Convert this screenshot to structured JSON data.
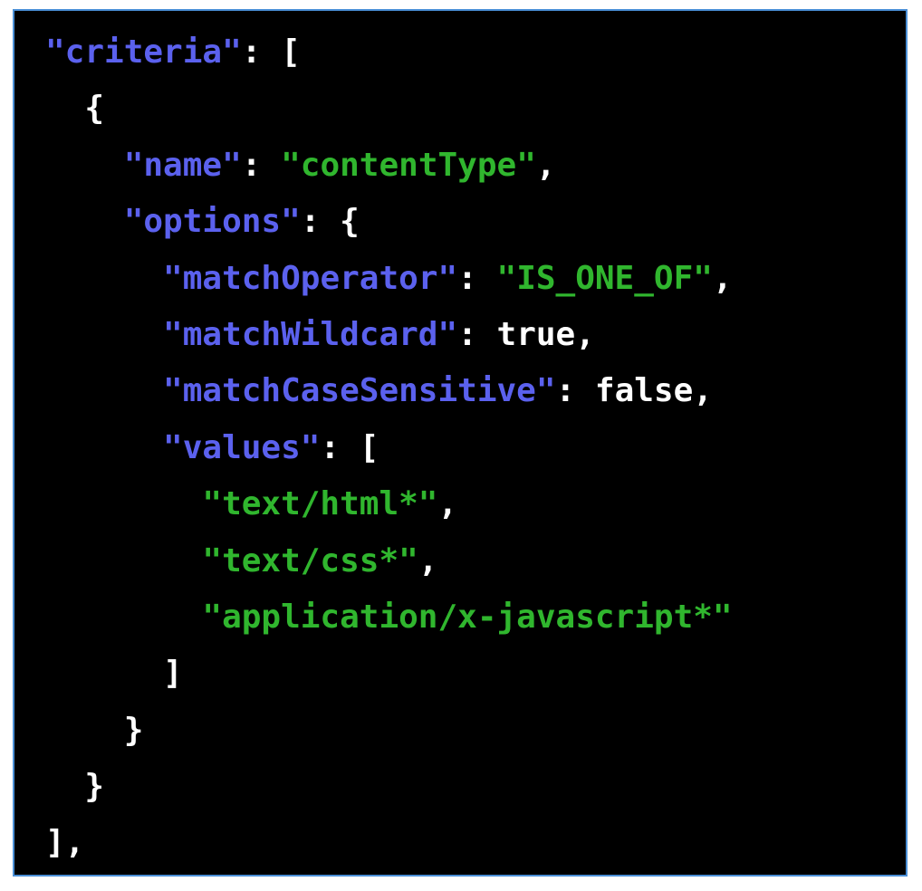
{
  "code_view": {
    "colors": {
      "background": "#000000",
      "border": "#4a8fd6",
      "key": "#5b61ee",
      "string": "#30b62e",
      "plain": "#ffffff"
    },
    "lines": [
      {
        "indent": "",
        "parts": [
          {
            "text": "\"criteria\"",
            "kind": "key"
          },
          {
            "text": ": [",
            "kind": "punct"
          }
        ]
      },
      {
        "indent": "  ",
        "parts": [
          {
            "text": "{",
            "kind": "punct"
          }
        ]
      },
      {
        "indent": "    ",
        "parts": [
          {
            "text": "\"name\"",
            "kind": "key"
          },
          {
            "text": ": ",
            "kind": "punct"
          },
          {
            "text": "\"contentType\"",
            "kind": "str"
          },
          {
            "text": ",",
            "kind": "punct"
          }
        ]
      },
      {
        "indent": "    ",
        "parts": [
          {
            "text": "\"options\"",
            "kind": "key"
          },
          {
            "text": ": {",
            "kind": "punct"
          }
        ]
      },
      {
        "indent": "      ",
        "parts": [
          {
            "text": "\"matchOperator\"",
            "kind": "key"
          },
          {
            "text": ": ",
            "kind": "punct"
          },
          {
            "text": "\"IS_ONE_OF\"",
            "kind": "str"
          },
          {
            "text": ",",
            "kind": "punct"
          }
        ]
      },
      {
        "indent": "      ",
        "parts": [
          {
            "text": "\"matchWildcard\"",
            "kind": "key"
          },
          {
            "text": ": ",
            "kind": "punct"
          },
          {
            "text": "true",
            "kind": "lit"
          },
          {
            "text": ",",
            "kind": "punct"
          }
        ]
      },
      {
        "indent": "      ",
        "parts": [
          {
            "text": "\"matchCaseSensitive\"",
            "kind": "key"
          },
          {
            "text": ": ",
            "kind": "punct"
          },
          {
            "text": "false",
            "kind": "lit"
          },
          {
            "text": ",",
            "kind": "punct"
          }
        ]
      },
      {
        "indent": "      ",
        "parts": [
          {
            "text": "\"values\"",
            "kind": "key"
          },
          {
            "text": ": [",
            "kind": "punct"
          }
        ]
      },
      {
        "indent": "        ",
        "parts": [
          {
            "text": "\"text/html*\"",
            "kind": "str"
          },
          {
            "text": ",",
            "kind": "punct"
          }
        ]
      },
      {
        "indent": "        ",
        "parts": [
          {
            "text": "\"text/css*\"",
            "kind": "str"
          },
          {
            "text": ",",
            "kind": "punct"
          }
        ]
      },
      {
        "indent": "        ",
        "parts": [
          {
            "text": "\"application/x-javascript*\"",
            "kind": "str"
          }
        ]
      },
      {
        "indent": "      ",
        "parts": [
          {
            "text": "]",
            "kind": "punct"
          }
        ]
      },
      {
        "indent": "    ",
        "parts": [
          {
            "text": "}",
            "kind": "punct"
          }
        ]
      },
      {
        "indent": "  ",
        "parts": [
          {
            "text": "}",
            "kind": "punct"
          }
        ]
      },
      {
        "indent": "",
        "parts": [
          {
            "text": "],",
            "kind": "punct"
          }
        ]
      }
    ]
  }
}
